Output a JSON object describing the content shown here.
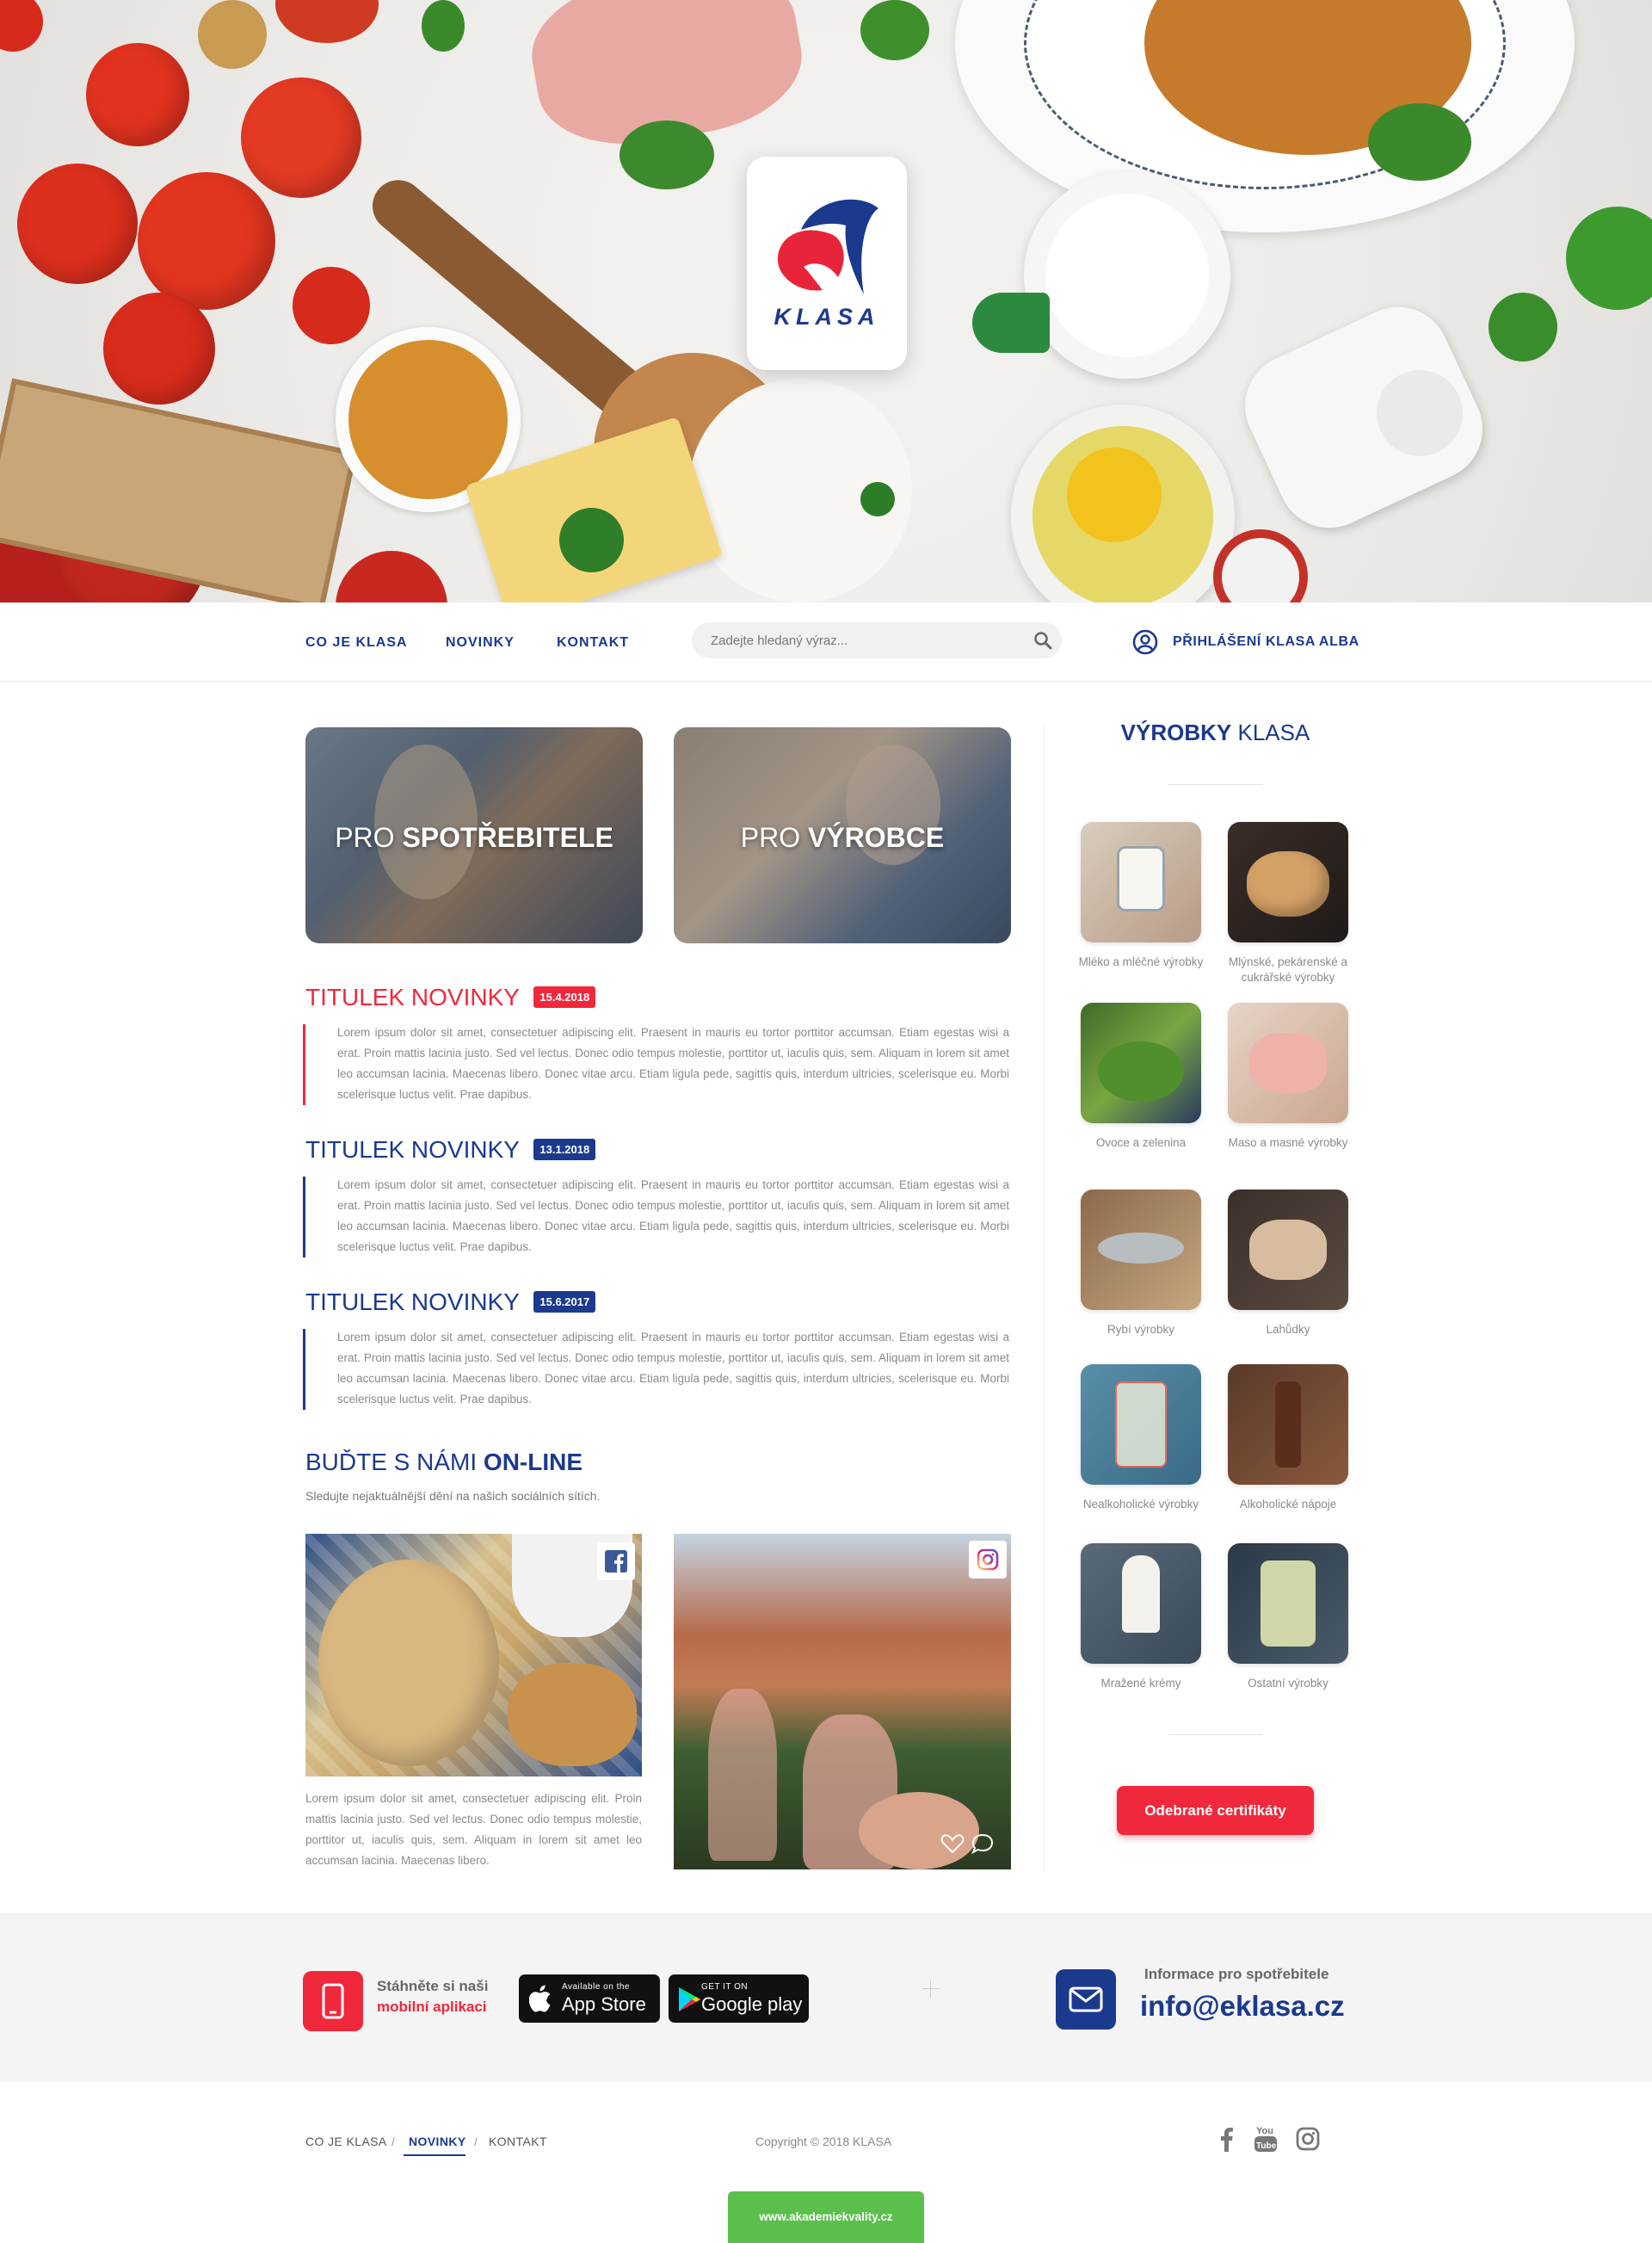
{
  "hero": {
    "logo_text": "KLASA"
  },
  "nav": {
    "links": [
      "CO JE KLASA",
      "NOVINKY",
      "KONTAKT"
    ],
    "search_placeholder": "Zadejte hledaný výraz...",
    "login_label": "PŘIHLÁŠENÍ KLASA ALBA"
  },
  "banners": [
    {
      "prefix": "PRO",
      "strong": "SPOTŘEBITELE"
    },
    {
      "prefix": "PRO",
      "strong": "VÝROBCE"
    }
  ],
  "news": [
    {
      "title": "TITULEK NOVINKY",
      "date": "15.4.2018",
      "color": "#f0283c",
      "text": "Lorem ipsum dolor sit amet, consectetuer adipiscing elit. Praesent in mauris eu tortor porttitor accumsan. Etiam egestas wisi a erat. Proin mattis lacinia justo. Sed vel lectus. Donec odio tempus molestie, porttitor ut, iaculis quis, sem. Aliquam in lorem sit amet leo accumsan lacinia. Maecenas libero. Donec vitae arcu. Etiam ligula pede, sagittis quis, interdum ultricies, scelerisque eu. Morbi scelerisque luctus velit. Prae dapibus."
    },
    {
      "title": "TITULEK NOVINKY",
      "date": "13.1.2018",
      "color": "#1b3a8e",
      "text": "Lorem ipsum dolor sit amet, consectetuer adipiscing elit. Praesent in mauris eu tortor porttitor accumsan. Etiam egestas wisi a erat. Proin mattis lacinia justo. Sed vel lectus. Donec odio tempus molestie, porttitor ut, iaculis quis, sem. Aliquam in lorem sit amet leo accumsan lacinia. Maecenas libero. Donec vitae arcu. Etiam ligula pede, sagittis quis, interdum ultricies, scelerisque eu. Morbi scelerisque luctus velit. Prae dapibus."
    },
    {
      "title": "TITULEK NOVINKY",
      "date": "15.6.2017",
      "color": "#1b3a8e",
      "text": "Lorem ipsum dolor sit amet, consectetuer adipiscing elit. Praesent in mauris eu tortor porttitor accumsan. Etiam egestas wisi a erat. Proin mattis lacinia justo. Sed vel lectus. Donec odio tempus molestie, porttitor ut, iaculis quis, sem. Aliquam in lorem sit amet leo accumsan lacinia. Maecenas libero. Donec vitae arcu. Etiam ligula pede, sagittis quis, interdum ultricies, scelerisque eu. Morbi scelerisque luctus velit. Prae dapibus."
    }
  ],
  "online": {
    "title_light": "BUĎTE S NÁMI",
    "title_strong": "ON-LINE",
    "subtitle": "Sledujte nejaktuálnější dění na našich sociálních sítích.",
    "fb_post_text": "Lorem ipsum dolor sit amet, consectetuer adipiscing elit. Proin mattis lacinia justo. Sed vel lectus. Donec odio tempus molestie, porttitor ut, iaculis quis, sem. Aliquam in lorem sit amet leo accumsan lacinia. Maecenas libero."
  },
  "sidebar": {
    "title_strong": "VÝROBKY",
    "title_light": "KLASA",
    "products": [
      {
        "label": "Mléko a mléčné výrobky",
        "icon": "milk-glass"
      },
      {
        "label": "Mlýnské, pekárenské a cukrářské výrobky",
        "icon": "bread"
      },
      {
        "label": "Ovoce a zelenina",
        "icon": "vegetables"
      },
      {
        "label": "Maso a masné výrobky",
        "icon": "meat"
      },
      {
        "label": "Rybí výrobky",
        "icon": "fish"
      },
      {
        "label": "Lahůdky",
        "icon": "delicacies"
      },
      {
        "label": "Nealkoholické výrobky",
        "icon": "lemonade"
      },
      {
        "label": "Alkoholické nápoje",
        "icon": "beer"
      },
      {
        "label": "Mražené krémy",
        "icon": "ice-cream"
      },
      {
        "label": "Ostatní výrobky",
        "icon": "jar"
      }
    ],
    "cert_button": "Odebrané certifikáty"
  },
  "app_band": {
    "line1": "Stáhněte si naši",
    "line2": "mobilní aplikaci",
    "appstore_small": "Available on the",
    "appstore_big": "App Store",
    "google_small": "GET IT ON",
    "google_big": "Google play",
    "info_label": "Informace pro spotřebitele",
    "email": "info@eklasa.cz"
  },
  "footer": {
    "links": [
      "CO JE KLASA",
      "NOVINKY",
      "KONTAKT"
    ],
    "separator": "/",
    "copyright": "Copyright © 2018 KLASA",
    "akad": "www.akademiekvality.cz"
  },
  "colors": {
    "blue": "#1b3a8e",
    "red": "#f0283c",
    "green": "#5bbf4b",
    "band": "#f4f4f4"
  }
}
